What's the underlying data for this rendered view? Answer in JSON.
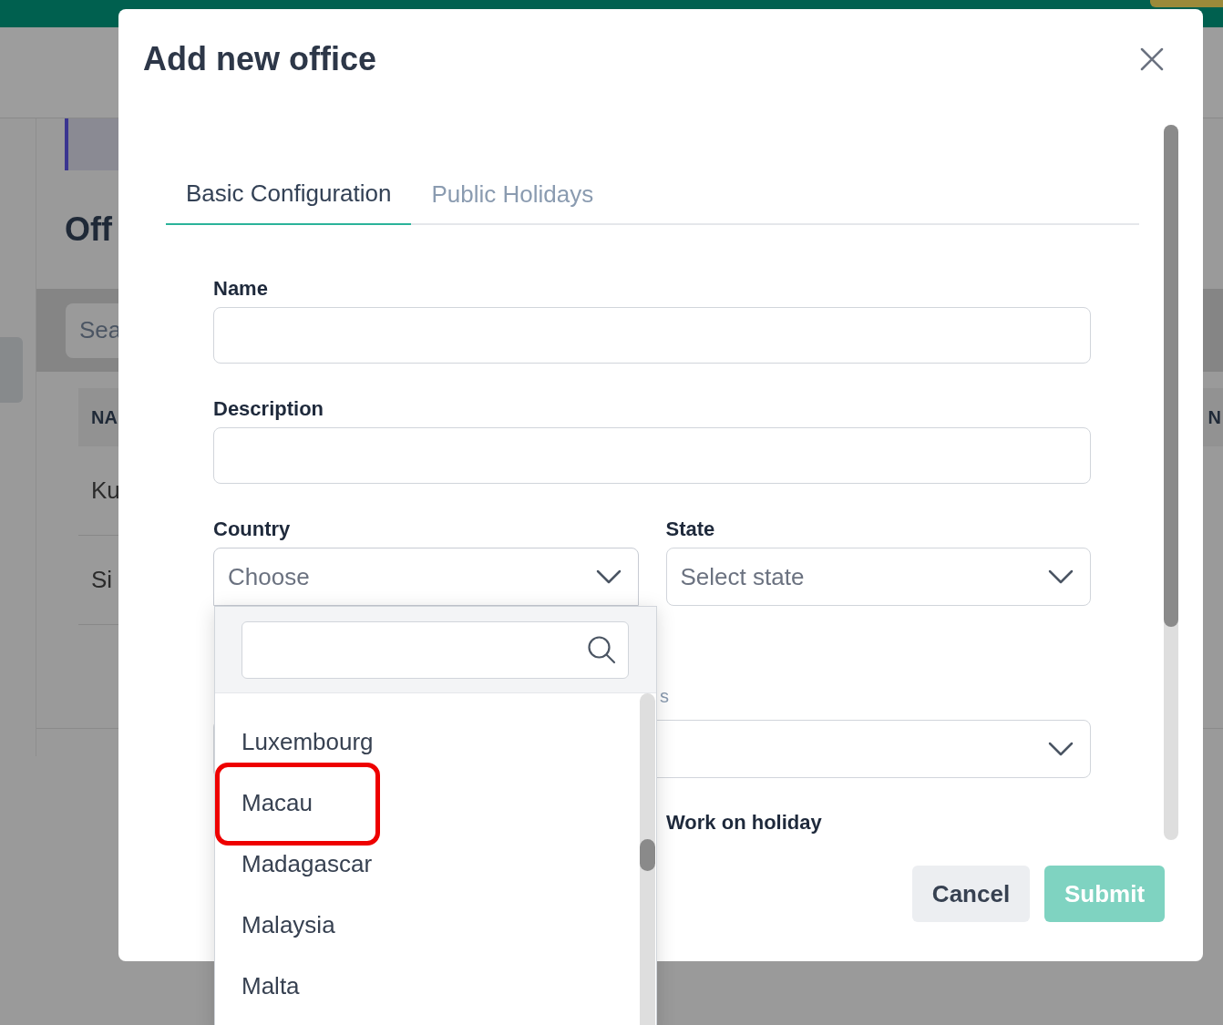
{
  "background": {
    "page_title": "Off",
    "search_placeholder": "Sea",
    "column_1": "NA",
    "column_right": "N",
    "rows": [
      "Ku",
      "Si"
    ]
  },
  "dialog": {
    "title": "Add new office",
    "tabs": [
      {
        "label": "Basic Configuration",
        "selected": true
      },
      {
        "label": "Public Holidays",
        "selected": false
      }
    ],
    "name": {
      "label": "Name"
    },
    "description": {
      "label": "Description"
    },
    "country": {
      "label": "Country",
      "placeholder": "Choose",
      "expanded": true
    },
    "state": {
      "label": "State",
      "placeholder": "Select state"
    },
    "hidden_field": {
      "label": "s"
    },
    "work_on_holiday": {
      "label": "Work on holiday"
    },
    "country_options": [
      {
        "label": "Luxembourg",
        "highlighted": false
      },
      {
        "label": "Macau",
        "highlighted": true
      },
      {
        "label": "Madagascar",
        "highlighted": false
      },
      {
        "label": "Malaysia",
        "highlighted": false
      },
      {
        "label": "Malta",
        "highlighted": false
      }
    ],
    "buttons": {
      "cancel": "Cancel",
      "submit": "Submit",
      "submit_disabled": true
    }
  }
}
